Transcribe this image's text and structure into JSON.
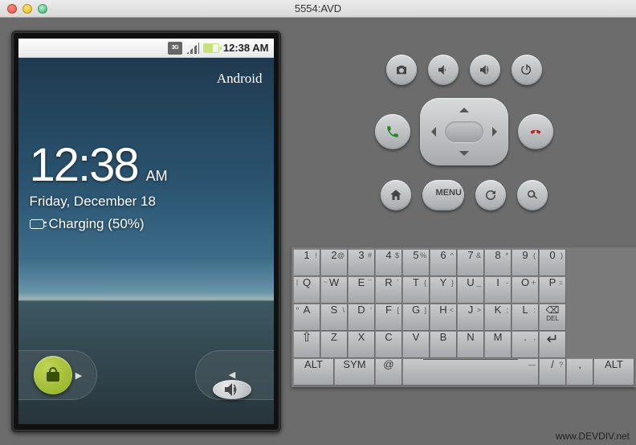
{
  "window": {
    "title": "5554:AVD"
  },
  "statusbar": {
    "network": "3G",
    "time": "12:38 AM"
  },
  "lock": {
    "brand": "Android",
    "time": "12:38",
    "ampm": "AM",
    "date": "Friday, December 18",
    "battery": "Charging (50%)"
  },
  "controls": {
    "row1": [
      "camera",
      "volume-down",
      "volume-up",
      "power"
    ],
    "mid": [
      "call",
      "dpad",
      "end-call"
    ],
    "row3": [
      "home",
      "menu",
      "back",
      "search"
    ],
    "menu_label": "MENU"
  },
  "keyboard": {
    "rows": [
      [
        {
          "m": "1",
          "a": "!"
        },
        {
          "m": "2",
          "a": "@"
        },
        {
          "m": "3",
          "a": "#"
        },
        {
          "m": "4",
          "a": "$"
        },
        {
          "m": "5",
          "a": "%"
        },
        {
          "m": "6",
          "a": "^"
        },
        {
          "m": "7",
          "a": "&"
        },
        {
          "m": "8",
          "a": "*"
        },
        {
          "m": "9",
          "a": "("
        },
        {
          "m": "0",
          "a": ")"
        }
      ],
      [
        {
          "m": "Q",
          "l": "|"
        },
        {
          "m": "W",
          "l": "~"
        },
        {
          "m": "E",
          "a": "¯"
        },
        {
          "m": "R",
          "a": "`"
        },
        {
          "m": "T",
          "a": "{"
        },
        {
          "m": "Y",
          "a": "}"
        },
        {
          "m": "U",
          "a": "_"
        },
        {
          "m": "I",
          "a": "-"
        },
        {
          "m": "O",
          "a": "+"
        },
        {
          "m": "P",
          "a": "="
        }
      ],
      [
        {
          "m": "A",
          "l": "º"
        },
        {
          "m": "S",
          "a": "\\"
        },
        {
          "m": "D",
          "a": "'"
        },
        {
          "m": "F",
          "a": "["
        },
        {
          "m": "G",
          "a": "]"
        },
        {
          "m": "H",
          "a": "<"
        },
        {
          "m": "J",
          "a": ">"
        },
        {
          "m": "K",
          "a": ";"
        },
        {
          "m": "L",
          "a": ":"
        },
        {
          "m": "DEL",
          "del": true
        }
      ],
      [
        {
          "m": "⇧",
          "shift": true
        },
        {
          "m": "Z"
        },
        {
          "m": "X"
        },
        {
          "m": "C"
        },
        {
          "m": "V"
        },
        {
          "m": "B"
        },
        {
          "m": "N"
        },
        {
          "m": "M"
        },
        {
          "m": ".",
          "a": ","
        },
        {
          "m": "↵",
          "enter": true
        }
      ],
      [
        {
          "m": "ALT",
          "w": "wide"
        },
        {
          "m": "SYM",
          "w": "wide"
        },
        {
          "m": "@"
        },
        {
          "m": "",
          "w": "space",
          "space": true,
          "a": "—"
        },
        {
          "m": "/",
          "a": "?"
        },
        {
          "m": ",",
          "a": ""
        },
        {
          "m": "ALT",
          "w": "wide"
        }
      ]
    ]
  },
  "watermark": "www.DEVDIV.net"
}
